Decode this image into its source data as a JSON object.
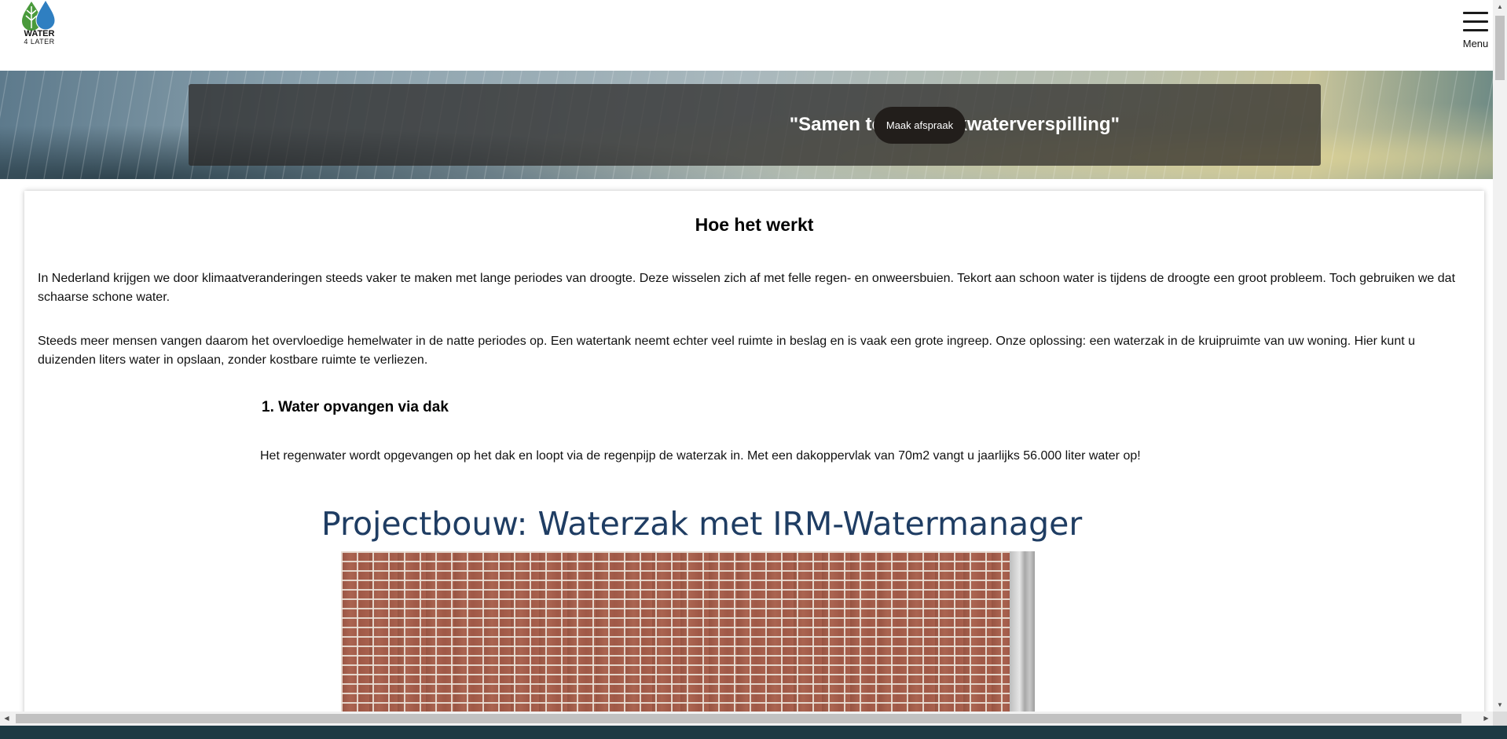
{
  "logo": {
    "line1": "WATER",
    "line2": "4 LATER",
    "colors": {
      "leaf": "#4a9a3c",
      "drop": "#2f7fc1"
    }
  },
  "header": {
    "menu_label": "Menu",
    "menu_icon": "hamburger-icon"
  },
  "hero": {
    "title": "\"Samen tegen drinkwaterverspilling\"",
    "cta_label": "Maak afspraak"
  },
  "content": {
    "section_title": "Hoe het werkt",
    "paragraphs": [
      "In Nederland krijgen we door klimaatveranderingen steeds vaker te maken met lange periodes van droogte. Deze wisselen zich af met felle regen- en onweersbuien. Tekort aan schoon water is tijdens de droogte een groot probleem. Toch gebruiken we dat schaarse schone water.",
      "Steeds meer mensen vangen daarom het overvloedige hemelwater in de natte periodes op. Een watertank neemt echter veel ruimte in beslag en is vaak een grote ingreep. Onze oplossing: een waterzak in de kruipruimte van uw woning. Hier kunt u duizenden liters water in opslaan, zonder kostbare ruimte te verliezen."
    ],
    "steps": [
      {
        "title": "1. Water opvangen via dak",
        "text": "Het regenwater wordt opgevangen op het dak en loopt via de regenpijp de waterzak in. Met een dakoppervlak van 70m2 vangt u jaarlijks 56.000 liter water op!"
      }
    ],
    "figure_title": "Projectbouw: Waterzak met IRM-Watermanager"
  },
  "scrollbars": {
    "up": "▲",
    "down": "▼",
    "left": "◀",
    "right": "▶"
  }
}
